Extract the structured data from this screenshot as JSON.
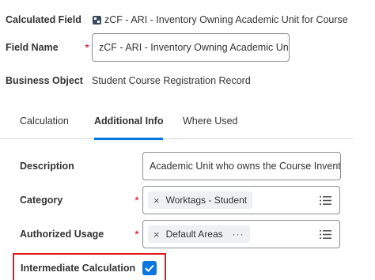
{
  "header": {
    "calculated_field_label": "Calculated Field",
    "calculated_field_value": "zCF - ARI - Inventory Owning Academic Unit for Course",
    "field_name_label": "Field Name",
    "field_name_value": "zCF - ARI - Inventory Owning Academic Unit for Course",
    "business_object_label": "Business Object",
    "business_object_value": "Student Course Registration Record",
    "required_marker": "*"
  },
  "tabs": [
    {
      "label": "Calculation",
      "active": false
    },
    {
      "label": "Additional Info",
      "active": true
    },
    {
      "label": "Where Used",
      "active": false
    }
  ],
  "form": {
    "description_label": "Description",
    "description_value": "Academic Unit who owns the Course Inventory",
    "category_label": "Category",
    "category_chip": "Worktags - Student",
    "authorized_usage_label": "Authorized Usage",
    "authorized_usage_chip": "Default Areas",
    "chip_more": "···",
    "intermediate_label": "Intermediate Calculation",
    "intermediate_checked": true
  },
  "icons": {
    "calculated_field": "calculated-field-icon",
    "chip_remove": "close-icon",
    "prompt": "list-prompt-icon",
    "checkmark": "check-icon"
  },
  "colors": {
    "accent": "#0875e1",
    "required": "#d0021b",
    "highlight_border": "#e21b1b"
  }
}
